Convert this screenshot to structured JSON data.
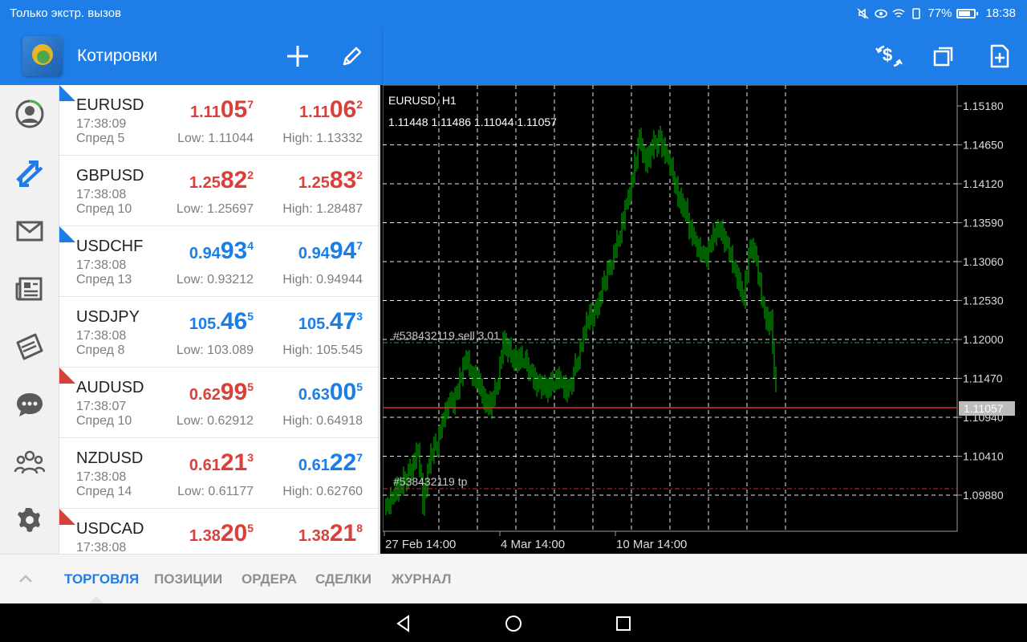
{
  "statusbar": {
    "carrier": "Только экстр. вызов",
    "battery": "77%",
    "time": "18:38"
  },
  "appbar": {
    "title": "Котировки"
  },
  "quotes": [
    {
      "symbol": "EURUSD",
      "time": "17:38:09",
      "spread": "Спред 5",
      "bid_small": "1.11",
      "bid_big": "05",
      "bid_sup": "7",
      "ask_small": "1.11",
      "ask_big": "06",
      "ask_sup": "2",
      "low": "Low: 1.11044",
      "high": "High: 1.13332",
      "color": "red",
      "marker": "#1a7ee6"
    },
    {
      "symbol": "GBPUSD",
      "time": "17:38:08",
      "spread": "Спред 10",
      "bid_small": "1.25",
      "bid_big": "82",
      "bid_sup": "2",
      "ask_small": "1.25",
      "ask_big": "83",
      "ask_sup": "2",
      "low": "Low: 1.25697",
      "high": "High: 1.28487",
      "color": "red",
      "marker": ""
    },
    {
      "symbol": "USDCHF",
      "time": "17:38:08",
      "spread": "Спред 13",
      "bid_small": "0.94",
      "bid_big": "93",
      "bid_sup": "4",
      "ask_small": "0.94",
      "ask_big": "94",
      "ask_sup": "7",
      "low": "Low: 0.93212",
      "high": "High: 0.94944",
      "color": "blue",
      "marker": "#1a7ee6"
    },
    {
      "symbol": "USDJPY",
      "time": "17:38:08",
      "spread": "Спред 8",
      "bid_small": "105.",
      "bid_big": "46",
      "bid_sup": "5",
      "ask_small": "105.",
      "ask_big": "47",
      "ask_sup": "3",
      "low": "Low: 103.089",
      "high": "High: 105.545",
      "color": "blue",
      "marker": ""
    },
    {
      "symbol": "AUDUSD",
      "time": "17:38:07",
      "spread": "Спред 10",
      "bid_small": "0.62",
      "bid_big": "99",
      "bid_sup": "5",
      "ask_small": "0.63",
      "ask_big": "00",
      "ask_sup": "5",
      "low": "Low: 0.62912",
      "high": "High: 0.64918",
      "color": "mixed",
      "marker": "#d9403a"
    },
    {
      "symbol": "NZDUSD",
      "time": "17:38:08",
      "spread": "Спред 14",
      "bid_small": "0.61",
      "bid_big": "21",
      "bid_sup": "3",
      "ask_small": "0.61",
      "ask_big": "22",
      "ask_sup": "7",
      "low": "Low: 0.61177",
      "high": "High: 0.62760",
      "color": "mixed",
      "marker": ""
    },
    {
      "symbol": "USDCAD",
      "time": "17:38:08",
      "spread": "",
      "bid_small": "1.38",
      "bid_big": "20",
      "bid_sup": "5",
      "ask_small": "1.38",
      "ask_big": "21",
      "ask_sup": "8",
      "low": "",
      "high": "",
      "color": "red",
      "marker": "#d9403a"
    }
  ],
  "chart": {
    "title": "EURUSD, H1",
    "ohlc": "1.11448 1.11486 1.11044 1.11057",
    "y_labels": [
      "1.15180",
      "1.14650",
      "1.14120",
      "1.13590",
      "1.13060",
      "1.12530",
      "1.12000",
      "1.11470",
      "1.10940",
      "1.10410",
      "1.09880"
    ],
    "x_labels": [
      "27 Feb 14:00",
      "4 Mar 14:00",
      "10 Mar 14:00"
    ],
    "current_price": "1.11057",
    "order_sell": "#538432119 sell 3.01",
    "order_tp": "#538432119 tp",
    "colors": {
      "candle": "#00c000",
      "grid": "#ffffff",
      "price_line": "#e03030",
      "sell_line": "#2a9e4a",
      "tp_line": "#d03030"
    }
  },
  "tabs": [
    "ТОРГОВЛЯ",
    "ПОЗИЦИИ",
    "ОРДЕРА",
    "СДЕЛКИ",
    "ЖУРНАЛ"
  ],
  "icons": {
    "rail": [
      "account-icon",
      "quotes-icon",
      "mail-icon",
      "news-icon",
      "calendar-icon",
      "chat-icon",
      "community-icon",
      "settings-icon"
    ],
    "appbar": [
      "add-icon",
      "edit-icon",
      "currency-icon",
      "windows-icon",
      "new-document-icon"
    ]
  }
}
